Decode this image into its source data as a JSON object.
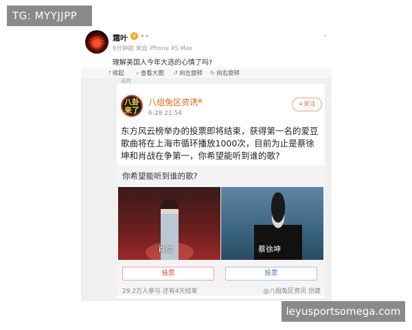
{
  "overlay": {
    "tg_tag": "TG: MYYJJPP",
    "watermark": "leyusportsomega.com"
  },
  "post": {
    "username": "霜叶",
    "verified_badge": "V",
    "meta": "6分钟前 来自 iPhone XS Max",
    "text": "理解美国人今年大选的心情了吗?"
  },
  "image_toolbar": [
    {
      "icon": "collapse-icon",
      "glyph": "⤒",
      "label": "收起"
    },
    {
      "icon": "zoom-icon",
      "glyph": "⌕",
      "label": "查看大图"
    },
    {
      "icon": "rotate-left-icon",
      "glyph": "↺",
      "label": "向左旋转"
    },
    {
      "icon": "rotate-right-icon",
      "glyph": "↻",
      "label": "向右旋转"
    }
  ],
  "fragment_text": "云片",
  "inner_post": {
    "avatar_text": "八卦来了",
    "author": "八组兔区资讯",
    "time": "6-28 21:54",
    "follow_label": "+关注",
    "text": "东方风云榜举办的投票即将结束，获得第一名的爱豆歌曲将在上海市循环播放1000次，目前为止是蔡徐坤和肖战在争第一，你希望能听到谁的歌?"
  },
  "poll": {
    "question": "你希望能听到谁的歌?",
    "options": [
      {
        "name": "肖战",
        "vote_label": "投票"
      },
      {
        "name": "蔡徐坤",
        "vote_label": "投票"
      }
    ],
    "footer": "29.2万人参与  还有4天结束",
    "author": "@八组兔区资讯 创建"
  },
  "colors": {
    "accent_orange": "#e0671b",
    "vote_red": "#e0473a",
    "vote_blue": "#4a78b8",
    "overlay_gray": "#8a8a8a"
  }
}
